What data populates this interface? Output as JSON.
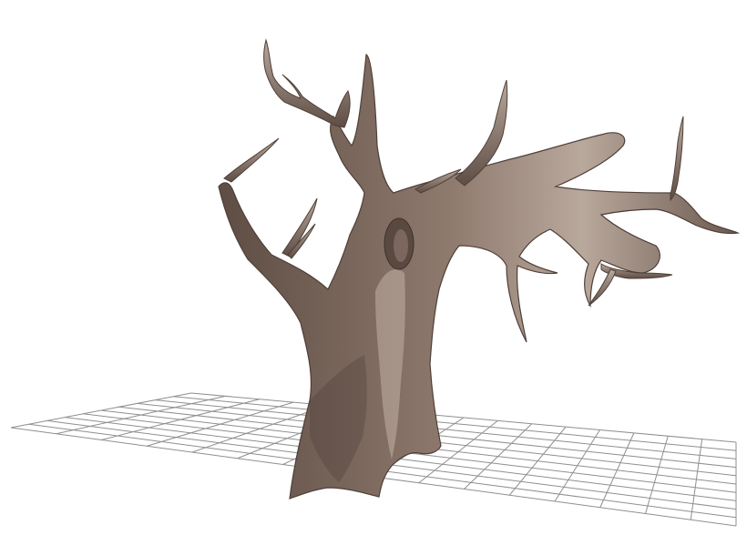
{
  "viewport": {
    "background_color": "#ffffff",
    "grid": {
      "visible": true,
      "color": "#8f8f8f",
      "rows": 10,
      "columns": 16
    },
    "model": {
      "name": "",
      "material_color": "#8f7a6e",
      "shadow_color": "#5e4d44",
      "highlight_color": "#b9a89c"
    }
  }
}
